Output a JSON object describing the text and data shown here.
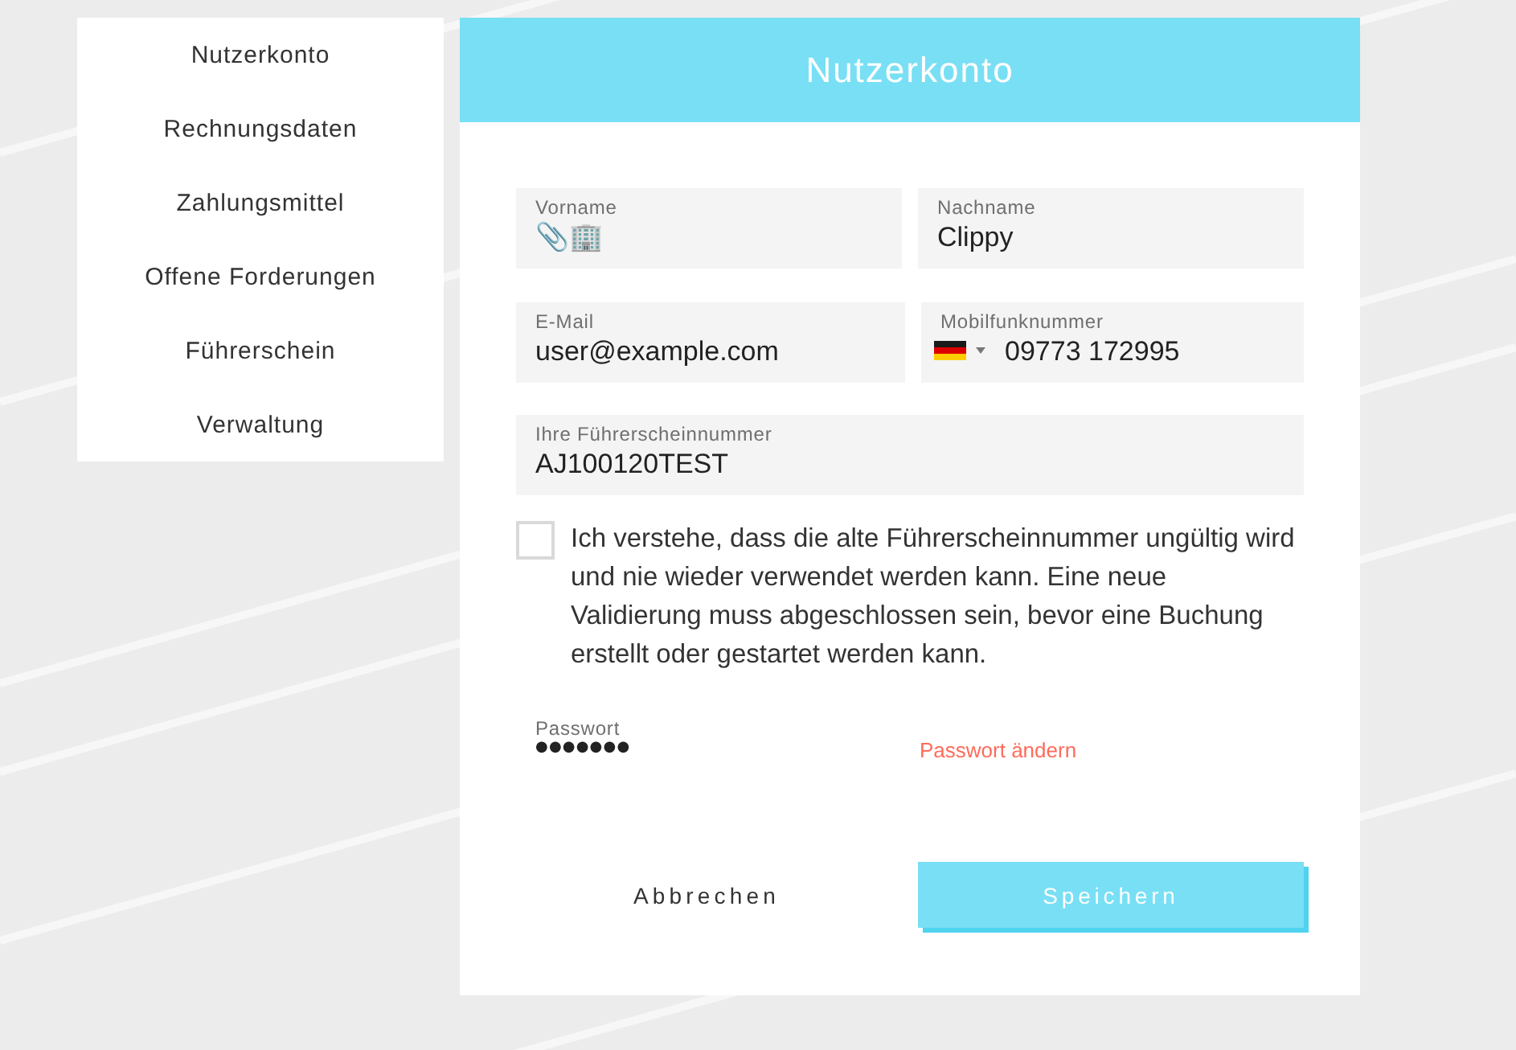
{
  "sidebar": {
    "items": [
      {
        "label": "Nutzerkonto"
      },
      {
        "label": "Rechnungsdaten"
      },
      {
        "label": "Zahlungsmittel"
      },
      {
        "label": "Offene Forderungen"
      },
      {
        "label": "Führerschein"
      },
      {
        "label": "Verwaltung"
      }
    ]
  },
  "card": {
    "title": "Nutzerkonto"
  },
  "form": {
    "rows": [
      {
        "fields": [
          {
            "kind": "text",
            "label": "Vorname",
            "value": "📎🏢"
          },
          {
            "kind": "text",
            "label": "Nachname",
            "value": "Clippy"
          }
        ]
      },
      {
        "fields": [
          {
            "kind": "text",
            "label": "E-Mail",
            "value": "user@example.com"
          },
          {
            "kind": "phone",
            "label": "Mobilfunknummer",
            "value": "09773 172995"
          }
        ]
      },
      {
        "fields": [
          {
            "kind": "text",
            "label": "Ihre Führerscheinnummer",
            "value": "AJ100120TEST"
          }
        ]
      }
    ],
    "consent": {
      "checked": false,
      "text": "Ich verstehe, dass die alte Führerscheinnummer ungültig wird und nie wieder verwendet werden kann. Eine neue Validierung muss abgeschlossen sein, bevor eine Buchung erstellt oder gestartet werden kann."
    },
    "password": {
      "label": "Passwort",
      "value": "●●●●●●●",
      "link": "Passwort ändern"
    }
  },
  "buttons": [
    {
      "kind": "secondary",
      "label": "Abbrechen"
    },
    {
      "kind": "primary",
      "label": "Speichern"
    }
  ]
}
